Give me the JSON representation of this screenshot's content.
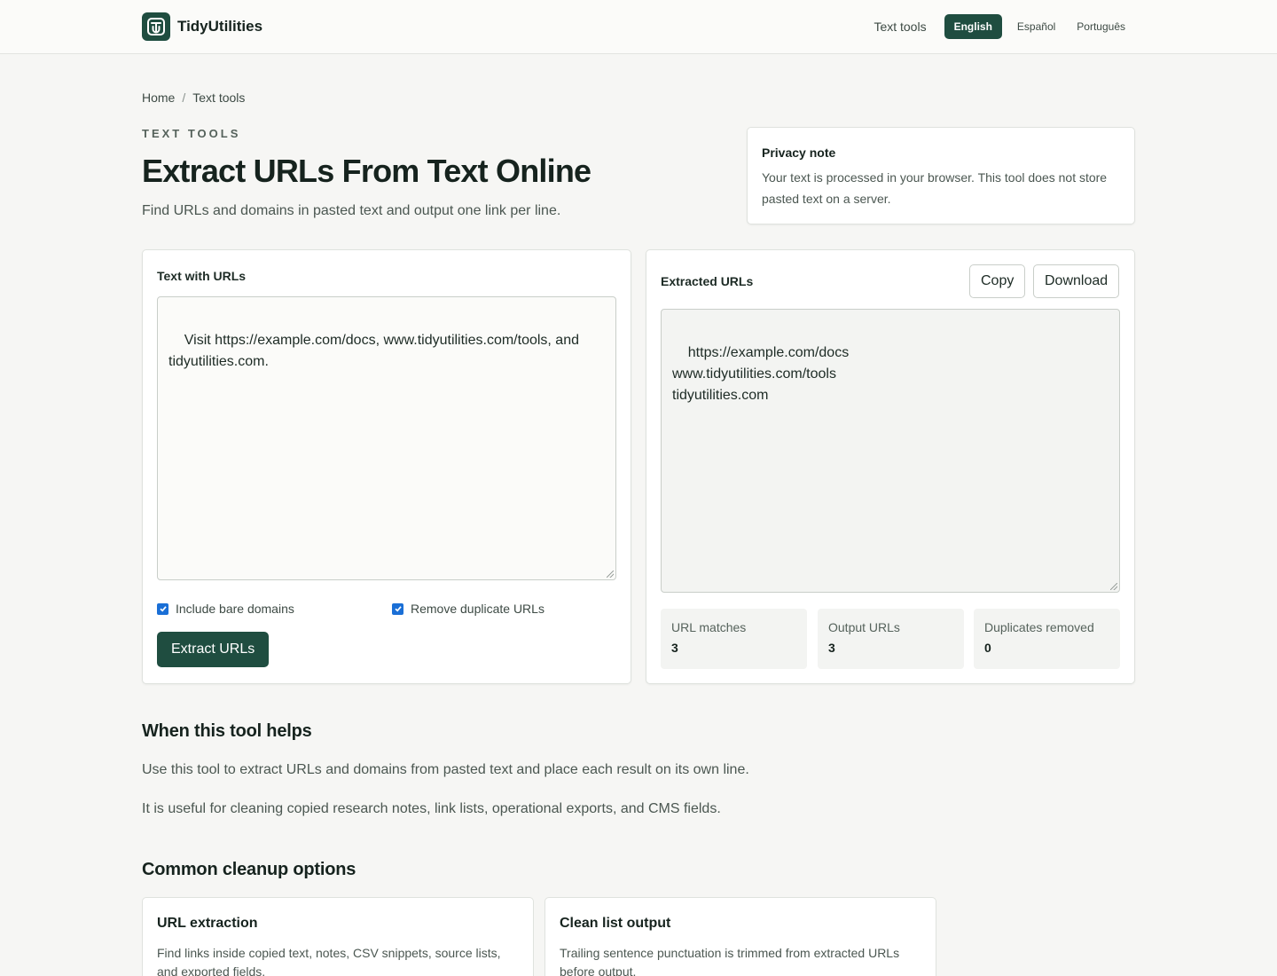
{
  "header": {
    "brand": "TidyUtilities",
    "nav_text_tools": "Text tools",
    "languages": [
      "English",
      "Español",
      "Português"
    ]
  },
  "breadcrumb": {
    "home": "Home",
    "separator": "/",
    "current": "Text tools"
  },
  "hero": {
    "eyebrow": "TEXT TOOLS",
    "title": "Extract URLs From Text Online",
    "lede": "Find URLs and domains in pasted text and output one link per line."
  },
  "privacy": {
    "title": "Privacy note",
    "text": "Your text is processed in your browser. This tool does not store pasted text on a server."
  },
  "input_panel": {
    "label": "Text with URLs",
    "value": "Visit https://example.com/docs, www.tidyutilities.com/tools, and tidyutilities.com.",
    "options": [
      {
        "label": "Include bare domains",
        "checked": true
      },
      {
        "label": "Remove duplicate URLs",
        "checked": true
      }
    ],
    "submit": "Extract URLs"
  },
  "output_panel": {
    "label": "Extracted URLs",
    "copy": "Copy",
    "download": "Download",
    "value": "https://example.com/docs\nwww.tidyutilities.com/tools\ntidyutilities.com",
    "stats": [
      {
        "label": "URL matches",
        "value": "3"
      },
      {
        "label": "Output URLs",
        "value": "3"
      },
      {
        "label": "Duplicates removed",
        "value": "0"
      }
    ]
  },
  "when": {
    "title": "When this tool helps",
    "p1": "Use this tool to extract URLs and domains from pasted text and place each result on its own line.",
    "p2": "It is useful for cleaning copied research notes, link lists, operational exports, and CMS fields."
  },
  "options_section": {
    "title": "Common cleanup options",
    "cards": [
      {
        "title": "URL extraction",
        "text": "Find links inside copied text, notes, CSV snippets, source lists, and exported fields."
      },
      {
        "title": "Clean list output",
        "text": "Trailing sentence punctuation is trimmed from extracted URLs before output."
      }
    ]
  },
  "colors": {
    "accent": "#1f4d40",
    "checkbox": "#1a6fd6",
    "background": "#f6f6f4"
  }
}
